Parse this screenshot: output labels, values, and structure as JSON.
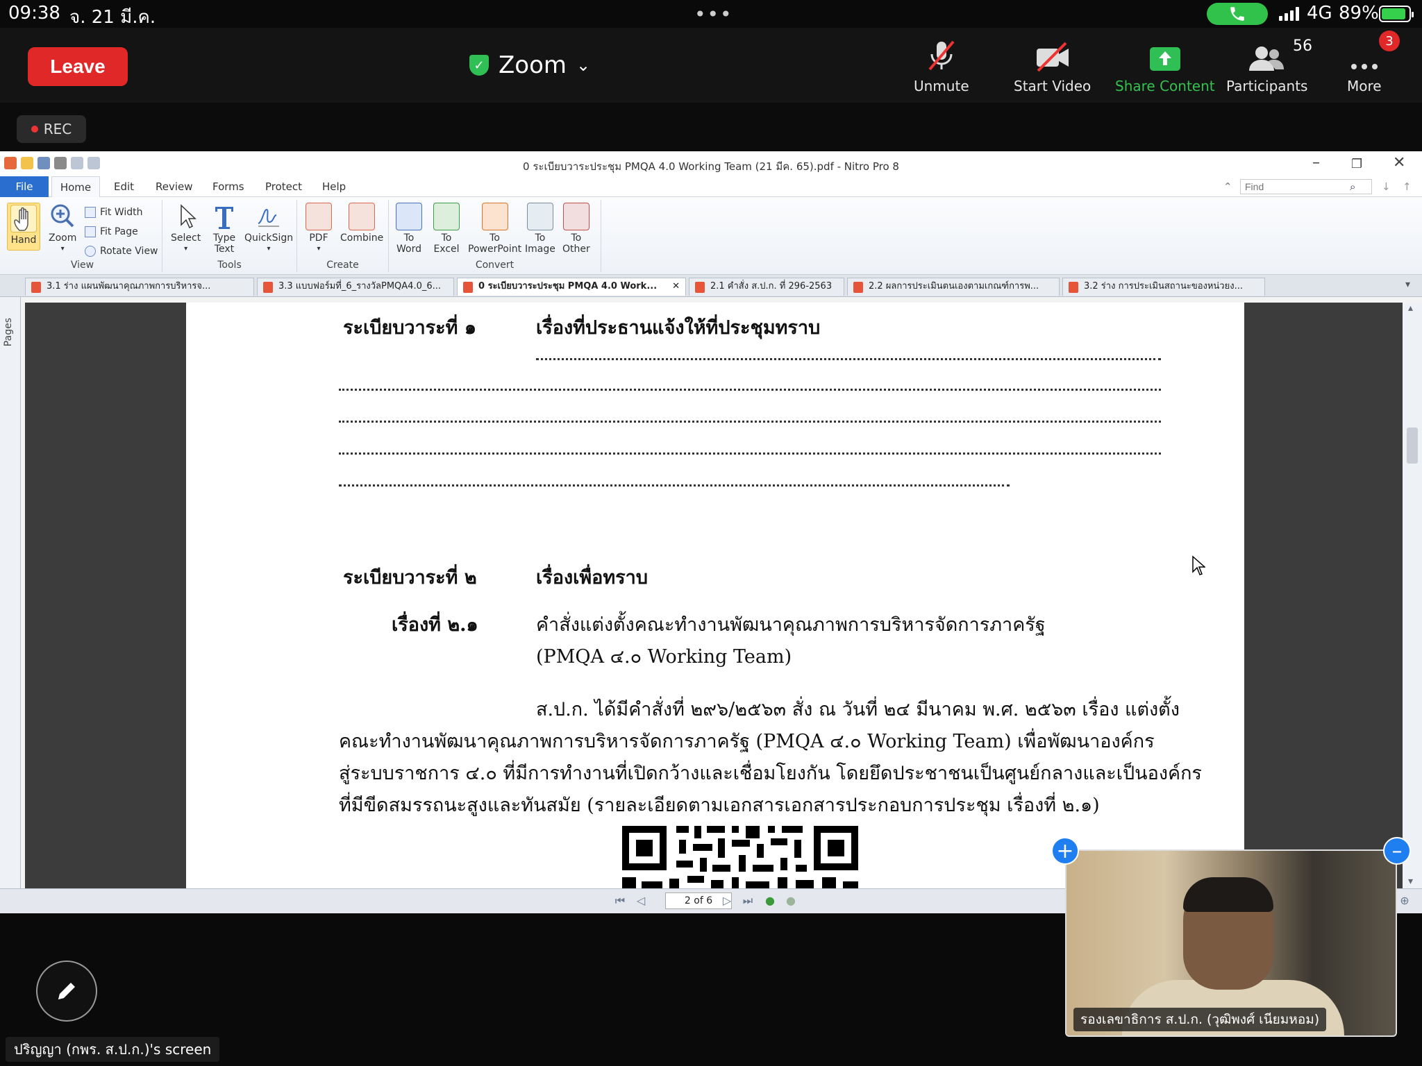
{
  "status": {
    "time": "09:38",
    "date": "จ. 21 มี.ค.",
    "network": "4G",
    "battery": "89%",
    "battery_level": 0.89
  },
  "zoom": {
    "leave_label": "Leave",
    "title": "Zoom",
    "controls": {
      "unmute": "Unmute",
      "start_video": "Start Video",
      "share": "Share Content",
      "participants": "Participants",
      "participants_count": "56",
      "more": "More",
      "more_badge": "3"
    },
    "rec": "REC",
    "share_label": "ปริญญา (กพร. ส.ป.ก.)'s screen",
    "video_name": "รองเลขาธิการ ส.ป.ก. (วุฒิพงศ์ เนียมหอม)"
  },
  "nitro": {
    "window_title": "0 ระเบียบวาระประชุม PMQA 4.0 Working Team (21 มีค. 65).pdf - Nitro Pro 8",
    "menu": {
      "file": "File",
      "home": "Home",
      "edit": "Edit",
      "review": "Review",
      "forms": "Forms",
      "protect": "Protect",
      "help": "Help"
    },
    "find_placeholder": "Find",
    "ribbon": {
      "hand": "Hand",
      "zoom": "Zoom",
      "fit_width": "Fit Width",
      "fit_page": "Fit Page",
      "rotate_view": "Rotate View",
      "view_group": "View",
      "select": "Select",
      "type_text_1": "Type",
      "type_text_2": "Text",
      "quicksign": "QuickSign",
      "tools_group": "Tools",
      "pdf": "PDF",
      "combine": "Combine",
      "create_group": "Create",
      "to": "To",
      "word": "Word",
      "excel": "Excel",
      "powerpoint": "PowerPoint",
      "image": "Image",
      "other": "Other",
      "convert_group": "Convert"
    },
    "tabs": [
      "3.1 ร่าง แผนพัฒนาคุณภาพการบริหารจ...",
      "3.3 แบบฟอร์มที่_6_รางวัลPMQA4.0_6...",
      "0 ระเบียบวาระประชุม PMQA 4.0 Work...",
      "2.1 คำสั่ง ส.ป.ก. ที่ 296-2563",
      "2.2 ผลการประเมินตนเองตามเกณฑ์การพ...",
      "3.2 ร่าง การประเมินสถานะของหน่วยง..."
    ],
    "side_label": "Pages",
    "page_indicator": "2 of 6"
  },
  "document": {
    "agenda1_label": "ระเบียบวาระที่ ๑",
    "agenda1_title": "เรื่องที่ประธานแจ้งให้ที่ประชุมทราบ",
    "agenda2_label": "ระเบียบวาระที่ ๒",
    "agenda2_title": "เรื่องเพื่อทราบ",
    "item_label": "เรื่องที่ ๒.๑",
    "item_title_1": "คำสั่งแต่งตั้งคณะทำงานพัฒนาคุณภาพการบริหารจัดการภาครัฐ",
    "item_title_2": "(PMQA ๔.๐ Working Team)",
    "para_1": "ส.ป.ก. ได้มีคำสั่งที่ ๒๙๖/๒๕๖๓ สั่ง ณ วันที่ ๒๔ มีนาคม พ.ศ. ๒๕๖๓ เรื่อง แต่งตั้ง",
    "para_2": "คณะทำงานพัฒนาคุณภาพการบริหารจัดการภาครัฐ (PMQA ๔.๐ Working Team) เพื่อพัฒนาองค์กร",
    "para_3": "สู่ระบบราชการ ๔.๐ ที่มีการทำงานที่เปิดกว้างและเชื่อมโยงกัน โดยยึดประชาชนเป็นศูนย์กลางและเป็นองค์กร",
    "para_4": "ที่มีขีดสมรรถนะสูงและทันสมัย (รายละเอียดตามเอกสารเอกสารประกอบการประชุม เรื่องที่ ๒.๑)"
  }
}
